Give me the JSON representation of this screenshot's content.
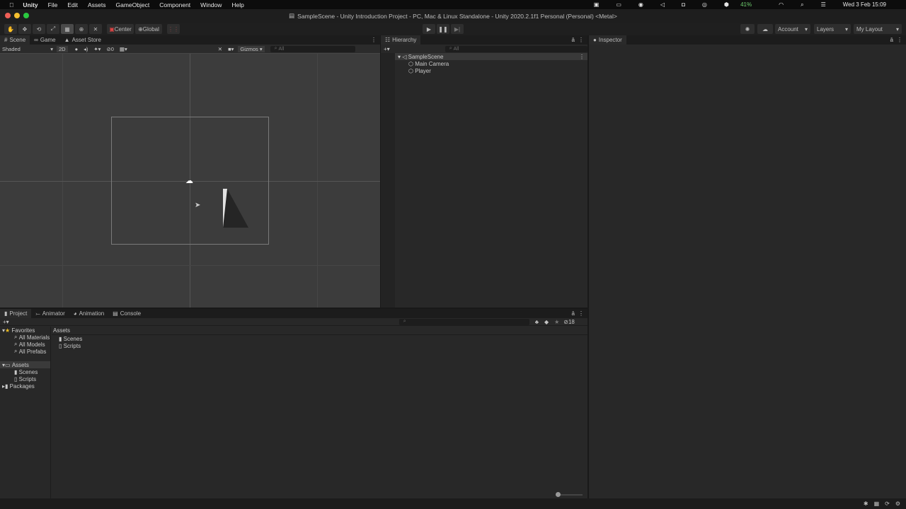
{
  "menubar": {
    "apple": "",
    "app": "Unity",
    "items": [
      "File",
      "Edit",
      "Assets",
      "GameObject",
      "Component",
      "Window",
      "Help"
    ],
    "battery": "41%",
    "datetime": "Wed 3 Feb  15:09"
  },
  "window": {
    "title": "SampleScene - Unity Introduction Project - PC, Mac & Linux Standalone - Unity 2020.2.1f1 Personal (Personal) <Metal>"
  },
  "toolbar": {
    "pivot": "Center",
    "space": "Global",
    "account": "Account",
    "layers": "Layers",
    "layout": "My Layout"
  },
  "scene_tabs": [
    "Scene",
    "Game",
    "Asset Store"
  ],
  "scene_toolbar": {
    "shading": "Shaded",
    "mode": "2D",
    "hidden_count": "0",
    "gizmos": "Gizmos",
    "search_placeholder": "All"
  },
  "hierarchy": {
    "tab": "Hierarchy",
    "search_placeholder": "All",
    "scene": "SampleScene",
    "items": [
      "Main Camera",
      "Player"
    ]
  },
  "inspector": {
    "tab": "Inspector"
  },
  "bottom_tabs": [
    "Project",
    "Animator",
    "Animation",
    "Console"
  ],
  "project": {
    "favorites": "Favorites",
    "favorite_items": [
      "All Materials",
      "All Models",
      "All Prefabs"
    ],
    "assets": "Assets",
    "asset_children": [
      "Scenes",
      "Scripts"
    ],
    "packages": "Packages",
    "breadcrumb": "Assets",
    "content": [
      "Scenes",
      "Scripts"
    ],
    "hidden_count": "18"
  },
  "colors": {
    "accent": "#3a79d8",
    "panel": "#282828",
    "scene": "#3c3c3c"
  }
}
